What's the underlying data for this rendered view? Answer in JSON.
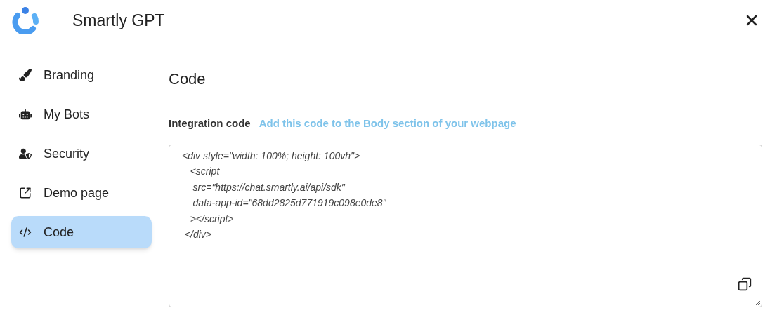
{
  "header": {
    "title": "Smartly GPT"
  },
  "sidebar": {
    "items": [
      {
        "kind": "brush",
        "label": "Branding",
        "selected": false
      },
      {
        "kind": "bot",
        "label": "My Bots",
        "selected": false
      },
      {
        "kind": "security",
        "label": "Security",
        "selected": false
      },
      {
        "kind": "external",
        "label": "Demo page",
        "selected": false
      },
      {
        "kind": "code",
        "label": "Code",
        "selected": true
      }
    ]
  },
  "content": {
    "heading": "Code",
    "label": "Integration code",
    "hint": "Add this code to the Body section of your webpage",
    "code_lines": [
      "<div style=\"width: 100%; height: 100vh\">",
      "   <script",
      "    src=\"https://chat.smartly.ai/api/sdk\"",
      "    data-app-id=\"68dd2825d771919c098e0de8\"",
      "   ></script>",
      " </div>"
    ]
  }
}
